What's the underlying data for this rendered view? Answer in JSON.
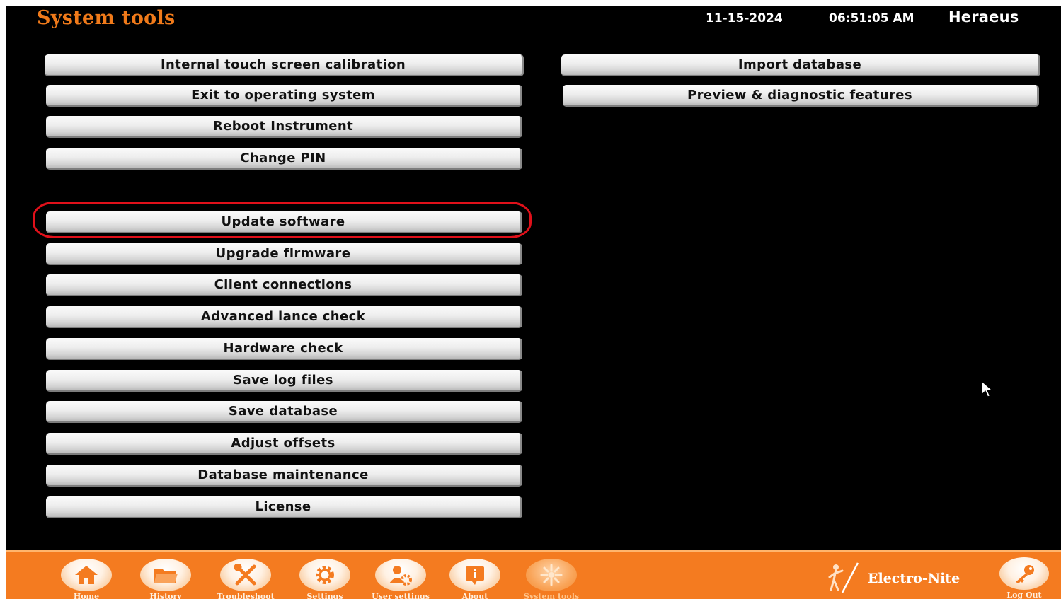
{
  "header": {
    "title": "System tools",
    "date": "11-15-2024",
    "time": "06:51:05 AM",
    "brand": "Heraeus"
  },
  "left_buttons": [
    "Internal touch screen calibration",
    "Exit to operating system",
    "Reboot Instrument",
    "Change PIN",
    "Update software",
    "Upgrade firmware",
    "Client connections",
    "Advanced lance check",
    "Hardware check",
    "Save log files",
    "Save database",
    "Adjust offsets",
    "Database maintenance",
    "License"
  ],
  "right_buttons": [
    "Import database",
    "Preview & diagnostic features"
  ],
  "highlighted_button": "Update software",
  "bottom_nav": {
    "items": [
      {
        "label": "Home",
        "icon": "home-icon"
      },
      {
        "label": "History",
        "icon": "folder-icon"
      },
      {
        "label": "Troubleshoot",
        "icon": "tools-icon"
      },
      {
        "label": "Settings",
        "icon": "gear-icon"
      },
      {
        "label": "User settings",
        "icon": "user-settings-icon"
      },
      {
        "label": "About",
        "icon": "info-icon"
      },
      {
        "label": "System tools",
        "icon": "system-tools-icon"
      }
    ],
    "active": "System tools",
    "logo_text": "Electro-Nite",
    "logout_label": "Log Out",
    "logout_icon": "key-icon"
  },
  "colors": {
    "accent": "#f47b20",
    "title": "#f07a1a",
    "background": "#000000",
    "highlight": "#e0101a"
  }
}
